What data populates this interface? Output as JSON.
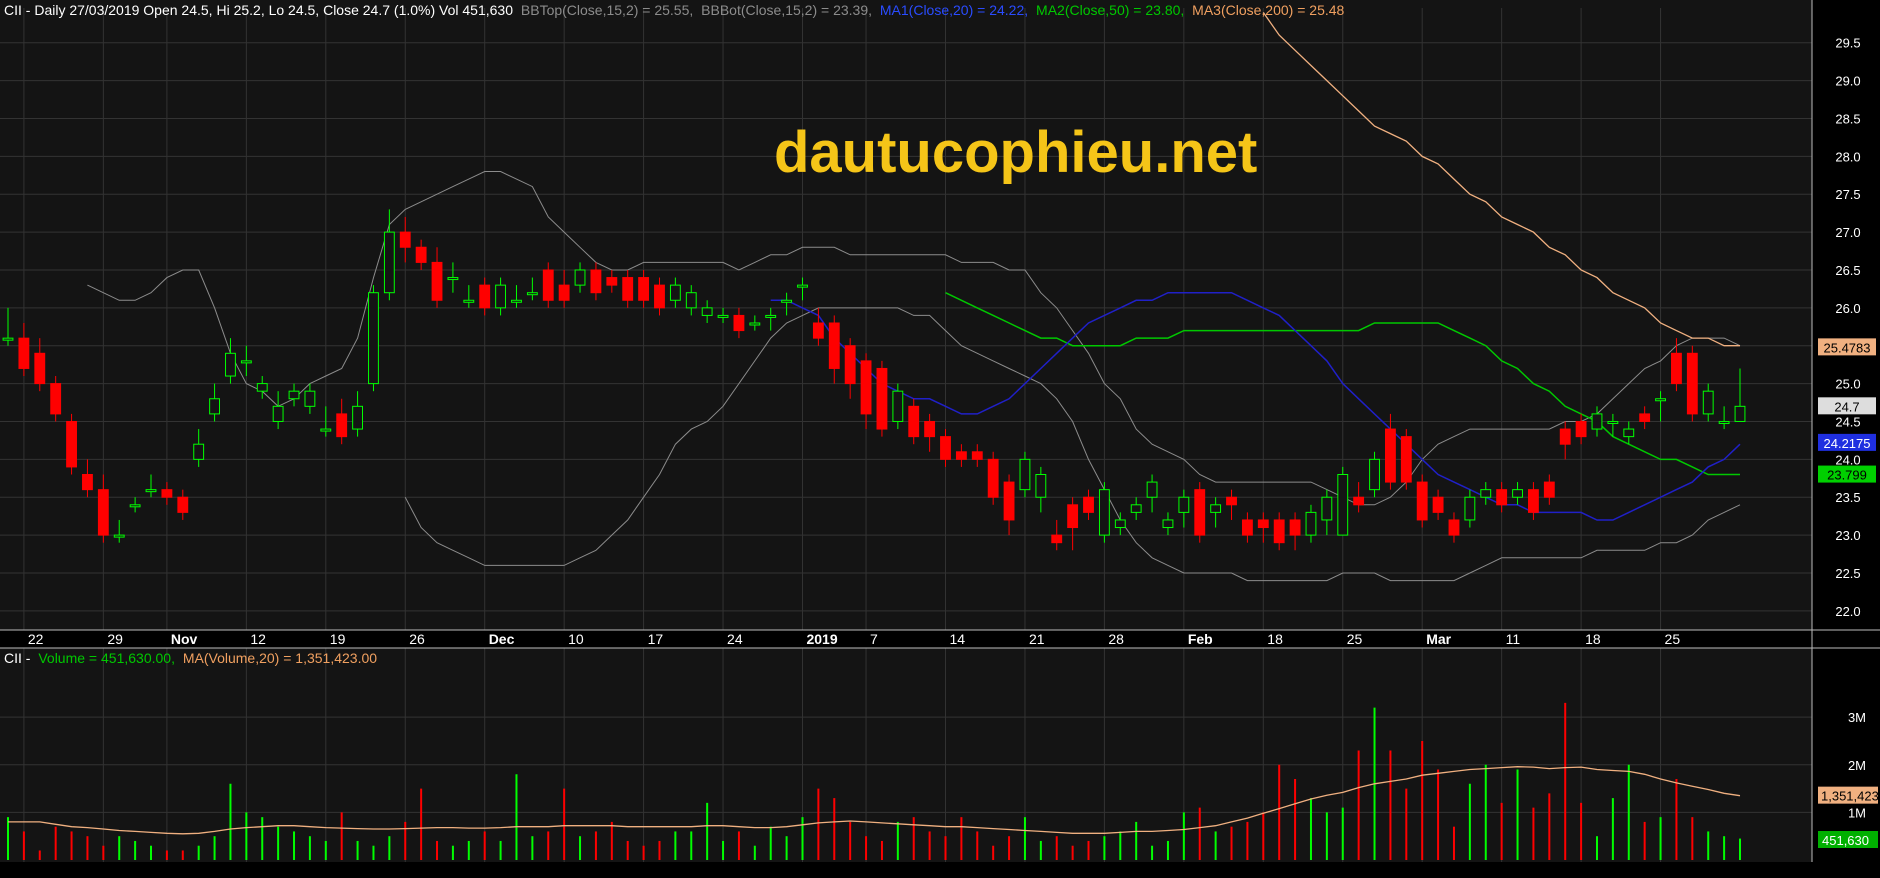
{
  "header": {
    "price_title": "CII - Daily 27/03/2019 Open 24.5, Hi 25.2, Lo 24.5, Close 24.7 (1.0%) Vol 451,630",
    "bbtop": "BBTop(Close,15,2) = 25.55,",
    "bbbot": "BBBot(Close,15,2) = 23.39,",
    "ma1": "MA1(Close,20) = 24.22,",
    "ma2": "MA2(Close,50) = 23.80,",
    "ma3": "MA3(Close,200) = 25.48",
    "volume_prefix": "CII -",
    "volume_label": "Volume = 451,630.00,",
    "volume_ma": "MA(Volume,20) = 1,351,423.00"
  },
  "watermark": "dautucophieu.net",
  "colors": {
    "background": "#000000",
    "panel": "#141414",
    "grid": "#333333",
    "up": "#00ff00",
    "down": "#ff0000",
    "bollinger": "#8c8c8c",
    "ma1": "#2020c8",
    "ma2": "#00c800",
    "ma3": "#f0b080",
    "watermark": "#f5c518"
  },
  "chart_data": [
    {
      "type": "candlestick",
      "ylim": [
        21.8,
        29.8
      ],
      "y_ticks": [
        "29.5",
        "29.0",
        "28.5",
        "28.0",
        "27.5",
        "27.0",
        "26.5",
        "26.0",
        "25.5",
        "25.0",
        "24.5",
        "24.0",
        "23.5",
        "23.0",
        "22.5",
        "22.0"
      ],
      "x_ticks": [
        "22",
        "29",
        "Nov",
        "12",
        "19",
        "26",
        "Dec",
        "10",
        "17",
        "24",
        "2019",
        "7",
        "14",
        "21",
        "28",
        "Feb",
        "18",
        "25",
        "Mar",
        "11",
        "18",
        "25"
      ],
      "x_tick_index": [
        1,
        6,
        10,
        15,
        20,
        25,
        30,
        35,
        40,
        45,
        50,
        54,
        59,
        64,
        69,
        74,
        79,
        84,
        89,
        94,
        99,
        104
      ],
      "last_values": {
        "ma3": "25.4783",
        "close": "24.7",
        "ma1": "24.2175",
        "ma2": "23.799"
      },
      "series": {
        "open": [
          25.6,
          25.6,
          25.4,
          25.0,
          24.5,
          23.8,
          23.6,
          23.0,
          23.4,
          23.6,
          23.6,
          23.5,
          24.0,
          24.6,
          25.1,
          25.3,
          24.9,
          24.5,
          24.8,
          24.7,
          24.4,
          24.6,
          24.4,
          25.0,
          26.2,
          27.0,
          26.8,
          26.6,
          26.4,
          26.1,
          26.3,
          26.0,
          26.1,
          26.2,
          26.5,
          26.3,
          26.3,
          26.5,
          26.4,
          26.4,
          26.4,
          26.3,
          26.1,
          26.0,
          25.9,
          25.9,
          25.9,
          25.8,
          25.9,
          26.1,
          26.3,
          25.8,
          25.8,
          25.5,
          25.3,
          25.2,
          24.5,
          24.7,
          24.5,
          24.3,
          24.1,
          24.1,
          24.0,
          23.7,
          23.6,
          23.5,
          23.0,
          23.4,
          23.5,
          23.0,
          23.1,
          23.3,
          23.5,
          23.1,
          23.3,
          23.6,
          23.3,
          23.5,
          23.2,
          23.2,
          23.2,
          23.2,
          23.0,
          23.2,
          23.0,
          23.5,
          23.6,
          24.4,
          24.3,
          23.7,
          23.5,
          23.2,
          23.2,
          23.5,
          23.6,
          23.5,
          23.6,
          23.7,
          24.4,
          24.5,
          24.4,
          24.5,
          24.3,
          24.6,
          24.8,
          25.4,
          25.4,
          24.6,
          24.5,
          24.5
        ],
        "close": [
          25.6,
          25.2,
          25.0,
          24.6,
          23.9,
          23.6,
          23.0,
          23.0,
          23.4,
          23.6,
          23.5,
          23.3,
          24.2,
          24.8,
          25.4,
          25.3,
          25.0,
          24.7,
          24.9,
          24.9,
          24.4,
          24.3,
          24.7,
          26.2,
          27.0,
          26.8,
          26.6,
          26.1,
          26.4,
          26.1,
          26.0,
          26.3,
          26.1,
          26.2,
          26.1,
          26.1,
          26.5,
          26.2,
          26.3,
          26.1,
          26.1,
          26.0,
          26.3,
          26.2,
          26.0,
          25.9,
          25.7,
          25.8,
          25.9,
          26.1,
          26.3,
          25.6,
          25.2,
          25.0,
          24.6,
          24.4,
          24.9,
          24.3,
          24.3,
          24.0,
          24.0,
          24.0,
          23.5,
          23.2,
          24.0,
          23.8,
          22.9,
          23.1,
          23.3,
          23.6,
          23.2,
          23.4,
          23.7,
          23.2,
          23.5,
          23.0,
          23.4,
          23.4,
          23.0,
          23.1,
          22.9,
          23.0,
          23.3,
          23.5,
          23.8,
          23.4,
          24.0,
          23.7,
          23.7,
          23.2,
          23.3,
          23.0,
          23.5,
          23.6,
          23.4,
          23.6,
          23.3,
          23.5,
          24.2,
          24.3,
          24.6,
          24.5,
          24.4,
          24.5,
          24.8,
          25.0,
          24.6,
          24.9,
          24.5,
          24.7
        ],
        "high": [
          26.0,
          25.8,
          25.6,
          25.1,
          24.6,
          24.0,
          23.8,
          23.2,
          23.5,
          23.8,
          23.7,
          23.6,
          24.4,
          25.0,
          25.6,
          25.5,
          25.1,
          24.9,
          25.0,
          25.0,
          24.7,
          24.8,
          24.9,
          26.3,
          27.3,
          27.2,
          26.9,
          26.8,
          26.6,
          26.3,
          26.4,
          26.4,
          26.3,
          26.4,
          26.6,
          26.5,
          26.6,
          26.6,
          26.5,
          26.5,
          26.5,
          26.4,
          26.4,
          26.3,
          26.1,
          26.0,
          26.0,
          25.9,
          26.0,
          26.2,
          26.4,
          26.0,
          25.9,
          25.6,
          25.4,
          25.3,
          25.0,
          24.8,
          24.6,
          24.4,
          24.2,
          24.2,
          24.1,
          23.8,
          24.1,
          23.9,
          23.2,
          23.5,
          23.6,
          23.7,
          23.3,
          23.5,
          23.8,
          23.3,
          23.6,
          23.7,
          23.5,
          23.6,
          23.3,
          23.3,
          23.3,
          23.3,
          23.4,
          23.6,
          23.9,
          23.7,
          24.1,
          24.6,
          24.4,
          23.8,
          23.6,
          23.3,
          23.6,
          23.7,
          23.7,
          23.7,
          23.7,
          23.8,
          24.5,
          24.6,
          24.7,
          24.6,
          24.5,
          24.7,
          24.9,
          25.6,
          25.5,
          25.0,
          24.7,
          25.2
        ],
        "low": [
          25.5,
          25.1,
          24.9,
          24.5,
          23.8,
          23.5,
          22.9,
          22.9,
          23.3,
          23.5,
          23.4,
          23.2,
          23.9,
          24.5,
          25.0,
          25.1,
          24.8,
          24.4,
          24.7,
          24.6,
          24.3,
          24.2,
          24.3,
          24.9,
          26.1,
          26.6,
          26.5,
          26.0,
          26.2,
          26.0,
          25.9,
          25.9,
          26.0,
          26.1,
          26.0,
          26.0,
          26.2,
          26.1,
          26.2,
          26.0,
          26.0,
          25.9,
          26.0,
          25.9,
          25.8,
          25.8,
          25.6,
          25.7,
          25.7,
          25.9,
          26.1,
          25.5,
          25.0,
          24.8,
          24.4,
          24.3,
          24.4,
          24.2,
          24.1,
          23.9,
          23.9,
          23.9,
          23.4,
          23.0,
          23.5,
          23.3,
          22.8,
          22.8,
          23.2,
          22.9,
          23.0,
          23.2,
          23.3,
          23.0,
          23.1,
          22.9,
          23.1,
          23.2,
          22.9,
          22.9,
          22.8,
          22.8,
          22.9,
          23.0,
          23.0,
          23.3,
          23.5,
          23.6,
          23.6,
          23.1,
          23.2,
          22.9,
          23.1,
          23.4,
          23.3,
          23.4,
          23.2,
          23.4,
          24.0,
          24.2,
          24.3,
          24.3,
          24.2,
          24.4,
          24.5,
          24.9,
          24.5,
          24.5,
          24.4,
          24.5
        ]
      },
      "overlays": {
        "bbtop": [
          26.3,
          26.2,
          26.1,
          26.1,
          26.2,
          26.4,
          26.5,
          26.5,
          26.0,
          25.4,
          25.0,
          24.9,
          24.7,
          24.8,
          25.0,
          25.1,
          25.2,
          25.6,
          26.4,
          27.1,
          27.3,
          27.4,
          27.5,
          27.6,
          27.7,
          27.8,
          27.8,
          27.7,
          27.6,
          27.2,
          27.0,
          26.8,
          26.6,
          26.5,
          26.5,
          26.6,
          26.6,
          26.6,
          26.6,
          26.6,
          26.6,
          26.5,
          26.6,
          26.7,
          26.7,
          26.8,
          26.8,
          26.8,
          26.7,
          26.7,
          26.7,
          26.7,
          26.7,
          26.7,
          26.7,
          26.6,
          26.6,
          26.6,
          26.5,
          26.5,
          26.2,
          26.0,
          25.7,
          25.4,
          25.0,
          24.8,
          24.4,
          24.2,
          24.1,
          24.0,
          23.8,
          23.7,
          23.7,
          23.7,
          23.7,
          23.7,
          23.7,
          23.7,
          23.6,
          23.5,
          23.4,
          23.4,
          23.5,
          23.7,
          24.0,
          24.2,
          24.3,
          24.4,
          24.4,
          24.4,
          24.4,
          24.4,
          24.4,
          24.5,
          24.5,
          24.6,
          24.8,
          25.0,
          25.2,
          25.3,
          25.5,
          25.6,
          25.6,
          25.6,
          25.5
        ],
        "bbbot": [
          23.5,
          23.1,
          22.9,
          22.8,
          22.7,
          22.6,
          22.6,
          22.6,
          22.6,
          22.6,
          22.6,
          22.7,
          22.8,
          23.0,
          23.2,
          23.5,
          23.8,
          24.2,
          24.4,
          24.5,
          24.7,
          25.0,
          25.3,
          25.6,
          25.8,
          25.9,
          26.0,
          26.0,
          26.0,
          26.0,
          26.0,
          26.0,
          25.9,
          25.9,
          25.7,
          25.5,
          25.4,
          25.3,
          25.2,
          25.1,
          25.0,
          24.8,
          24.5,
          24.0,
          23.6,
          23.2,
          22.9,
          22.7,
          22.6,
          22.5,
          22.5,
          22.5,
          22.5,
          22.4,
          22.4,
          22.4,
          22.4,
          22.4,
          22.4,
          22.5,
          22.5,
          22.5,
          22.4,
          22.4,
          22.4,
          22.4,
          22.4,
          22.5,
          22.6,
          22.7,
          22.7,
          22.7,
          22.7,
          22.7,
          22.7,
          22.8,
          22.8,
          22.8,
          22.8,
          22.9,
          22.9,
          23.0,
          23.2,
          23.3,
          23.4
        ],
        "ma1": [
          26.1,
          26.1,
          26.0,
          25.9,
          25.6,
          25.4,
          25.2,
          25.0,
          24.9,
          24.8,
          24.8,
          24.7,
          24.6,
          24.6,
          24.7,
          24.8,
          25.0,
          25.2,
          25.4,
          25.6,
          25.8,
          25.9,
          26.0,
          26.1,
          26.1,
          26.2,
          26.2,
          26.2,
          26.2,
          26.2,
          26.1,
          26.0,
          25.9,
          25.7,
          25.5,
          25.3,
          25.0,
          24.8,
          24.6,
          24.4,
          24.2,
          24.0,
          23.8,
          23.7,
          23.6,
          23.5,
          23.4,
          23.4,
          23.3,
          23.3,
          23.3,
          23.3,
          23.2,
          23.2,
          23.3,
          23.4,
          23.5,
          23.6,
          23.7,
          23.9,
          24.0,
          24.2
        ],
        "ma2": [
          26.2,
          26.1,
          26.0,
          25.9,
          25.8,
          25.7,
          25.6,
          25.6,
          25.5,
          25.5,
          25.5,
          25.5,
          25.6,
          25.6,
          25.6,
          25.7,
          25.7,
          25.7,
          25.7,
          25.7,
          25.7,
          25.7,
          25.7,
          25.7,
          25.7,
          25.7,
          25.7,
          25.8,
          25.8,
          25.8,
          25.8,
          25.8,
          25.7,
          25.6,
          25.5,
          25.3,
          25.2,
          25.0,
          24.9,
          24.7,
          24.6,
          24.5,
          24.3,
          24.2,
          24.1,
          24.0,
          24.0,
          23.9,
          23.8,
          23.8,
          23.8
        ],
        "ma3": [
          29.9,
          29.6,
          29.4,
          29.2,
          29.0,
          28.8,
          28.6,
          28.4,
          28.3,
          28.2,
          28.0,
          27.9,
          27.7,
          27.5,
          27.4,
          27.2,
          27.1,
          27.0,
          26.8,
          26.7,
          26.5,
          26.4,
          26.2,
          26.1,
          26.0,
          25.8,
          25.7,
          25.6,
          25.6,
          25.5,
          25.5
        ]
      }
    },
    {
      "type": "bar",
      "y_ticks": [
        "3M",
        "2M",
        "1M"
      ],
      "ylim": [
        0,
        4200000
      ],
      "last_values": {
        "volume_ma": "1,351,423",
        "volume": "451,630"
      },
      "volume": [
        0.9,
        0.6,
        0.2,
        0.7,
        0.6,
        0.5,
        0.3,
        0.5,
        0.4,
        0.3,
        0.2,
        0.2,
        0.3,
        0.5,
        1.6,
        1.0,
        0.9,
        0.7,
        0.6,
        0.5,
        0.4,
        1.0,
        0.4,
        0.3,
        0.5,
        0.8,
        1.5,
        0.4,
        0.3,
        0.4,
        0.6,
        0.4,
        1.8,
        0.5,
        0.6,
        1.5,
        0.5,
        0.6,
        0.8,
        0.4,
        0.3,
        0.4,
        0.6,
        0.6,
        1.2,
        0.4,
        0.6,
        0.3,
        0.7,
        0.5,
        0.9,
        1.5,
        1.3,
        0.8,
        0.5,
        0.4,
        0.8,
        0.9,
        0.6,
        0.5,
        0.9,
        0.6,
        0.3,
        0.5,
        0.9,
        0.4,
        0.5,
        0.3,
        0.4,
        0.5,
        0.6,
        0.8,
        0.3,
        0.4,
        1.0,
        1.1,
        0.6,
        0.7,
        0.8,
        1.0,
        2.0,
        1.7,
        1.3,
        1.0,
        1.1,
        2.3,
        3.2,
        2.3,
        1.5,
        2.5,
        1.9,
        0.7,
        1.6,
        2.0,
        1.2,
        1.9,
        1.1,
        1.4,
        3.3,
        1.2,
        0.5,
        1.3,
        2.0,
        0.8,
        0.9,
        1.7,
        0.9,
        0.6,
        0.5,
        0.45
      ],
      "volume_ma": [
        0.8,
        0.8,
        0.8,
        0.75,
        0.7,
        0.68,
        0.65,
        0.62,
        0.6,
        0.58,
        0.56,
        0.55,
        0.56,
        0.6,
        0.65,
        0.68,
        0.7,
        0.72,
        0.72,
        0.7,
        0.68,
        0.67,
        0.66,
        0.65,
        0.65,
        0.66,
        0.67,
        0.68,
        0.68,
        0.67,
        0.67,
        0.68,
        0.7,
        0.7,
        0.7,
        0.72,
        0.72,
        0.72,
        0.72,
        0.7,
        0.7,
        0.7,
        0.7,
        0.7,
        0.72,
        0.72,
        0.7,
        0.68,
        0.68,
        0.7,
        0.74,
        0.78,
        0.8,
        0.82,
        0.8,
        0.78,
        0.76,
        0.74,
        0.72,
        0.7,
        0.7,
        0.68,
        0.66,
        0.64,
        0.62,
        0.6,
        0.58,
        0.56,
        0.56,
        0.56,
        0.58,
        0.6,
        0.6,
        0.62,
        0.64,
        0.68,
        0.72,
        0.8,
        0.88,
        0.98,
        1.08,
        1.18,
        1.28,
        1.36,
        1.42,
        1.52,
        1.6,
        1.65,
        1.7,
        1.78,
        1.82,
        1.86,
        1.9,
        1.92,
        1.94,
        1.96,
        1.95,
        1.92,
        1.94,
        1.95,
        1.9,
        1.88,
        1.86,
        1.8,
        1.7,
        1.62,
        1.55,
        1.48,
        1.4,
        1.35
      ]
    }
  ]
}
